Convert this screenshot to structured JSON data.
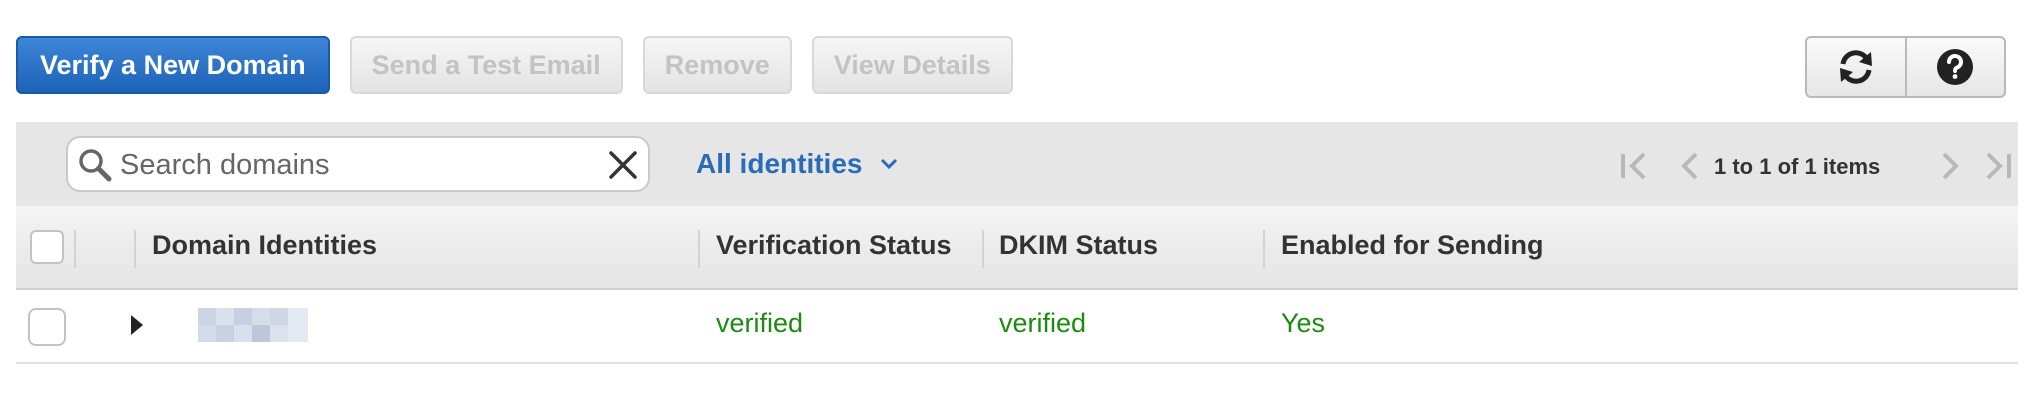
{
  "toolbar": {
    "verify_label": "Verify a New Domain",
    "test_email_label": "Send a Test Email",
    "remove_label": "Remove",
    "view_details_label": "View Details",
    "icons": [
      "refresh-icon",
      "help-icon"
    ]
  },
  "filter": {
    "search_placeholder": "Search domains",
    "dropdown_label": "All identities",
    "pager_text": "1 to 1 of 1 items"
  },
  "table": {
    "columns": [
      "Domain Identities",
      "Verification Status",
      "DKIM Status",
      "Enabled for Sending"
    ],
    "rows": [
      {
        "domain": "",
        "verification_status": "verified",
        "dkim_status": "verified",
        "enabled_for_sending": "Yes"
      }
    ]
  },
  "colors": {
    "primary": "#1d63b8",
    "link": "#2a6bb5",
    "success": "#1d8a12",
    "header_bg": "#e6e6e6"
  }
}
